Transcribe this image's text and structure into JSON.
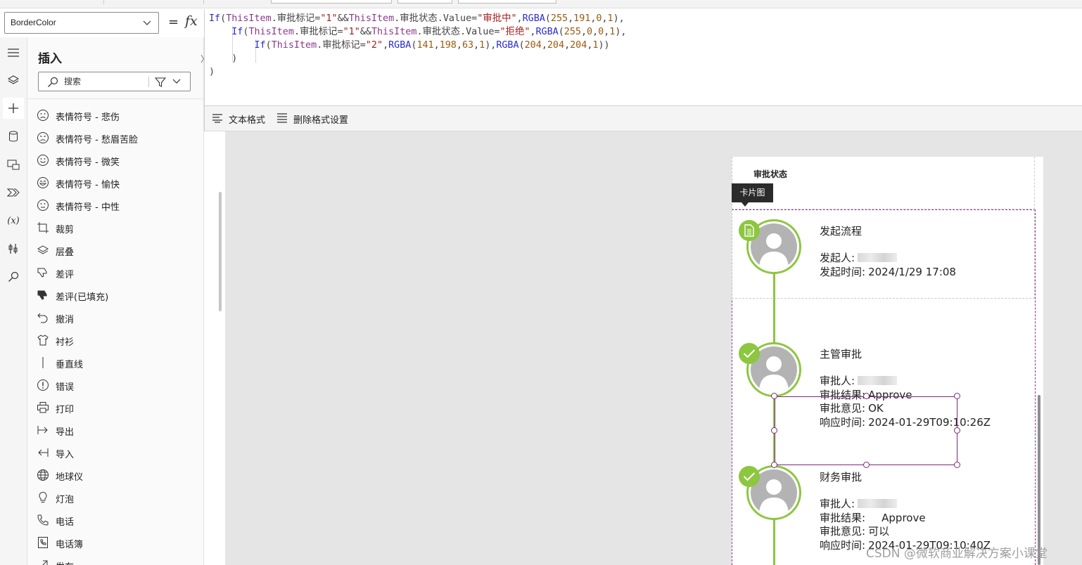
{
  "property": {
    "selected": "BorderColor",
    "equals": "=",
    "fx": "fx"
  },
  "formula": {
    "lines": [
      [
        {
          "t": "If",
          "c": "k"
        },
        {
          "t": "(",
          "c": "p"
        },
        {
          "t": "ThisItem",
          "c": "i"
        },
        {
          "t": ".审批标记=",
          "c": "p"
        },
        {
          "t": "\"1\"",
          "c": "s"
        },
        {
          "t": "&&",
          "c": "p"
        },
        {
          "t": "ThisItem",
          "c": "i"
        },
        {
          "t": ".审批状态.Value=",
          "c": "p"
        },
        {
          "t": "\"审批中\"",
          "c": "s"
        },
        {
          "t": ",",
          "c": "p"
        },
        {
          "t": "RGBA",
          "c": "k"
        },
        {
          "t": "(",
          "c": "p"
        },
        {
          "t": "255",
          "c": "n"
        },
        {
          "t": ",",
          "c": "p"
        },
        {
          "t": "191",
          "c": "n"
        },
        {
          "t": ",",
          "c": "p"
        },
        {
          "t": "0",
          "c": "n"
        },
        {
          "t": ",",
          "c": "p"
        },
        {
          "t": "1",
          "c": "n"
        },
        {
          "t": "),",
          "c": "p"
        }
      ],
      [
        {
          "t": "    ",
          "c": "p"
        },
        {
          "t": "If",
          "c": "k"
        },
        {
          "t": "(",
          "c": "p"
        },
        {
          "t": "ThisItem",
          "c": "i"
        },
        {
          "t": ".审批标记=",
          "c": "p"
        },
        {
          "t": "\"1\"",
          "c": "s"
        },
        {
          "t": "&&",
          "c": "p"
        },
        {
          "t": "ThisItem",
          "c": "i"
        },
        {
          "t": ".审批状态.Value=",
          "c": "p"
        },
        {
          "t": "\"拒绝\"",
          "c": "s"
        },
        {
          "t": ",",
          "c": "p"
        },
        {
          "t": "RGBA",
          "c": "k"
        },
        {
          "t": "(",
          "c": "p"
        },
        {
          "t": "255",
          "c": "n"
        },
        {
          "t": ",",
          "c": "p"
        },
        {
          "t": "0",
          "c": "n"
        },
        {
          "t": ",",
          "c": "p"
        },
        {
          "t": "0",
          "c": "n"
        },
        {
          "t": ",",
          "c": "p"
        },
        {
          "t": "1",
          "c": "n"
        },
        {
          "t": "),",
          "c": "p"
        }
      ],
      [
        {
          "t": "        ",
          "c": "p"
        },
        {
          "t": "If",
          "c": "k"
        },
        {
          "t": "(",
          "c": "p"
        },
        {
          "t": "ThisItem",
          "c": "i"
        },
        {
          "t": ".审批标记=",
          "c": "p"
        },
        {
          "t": "\"2\"",
          "c": "s"
        },
        {
          "t": ",",
          "c": "p"
        },
        {
          "t": "RGBA",
          "c": "k"
        },
        {
          "t": "(",
          "c": "p"
        },
        {
          "t": "141",
          "c": "n"
        },
        {
          "t": ",",
          "c": "p"
        },
        {
          "t": "198",
          "c": "n"
        },
        {
          "t": ",",
          "c": "p"
        },
        {
          "t": "63",
          "c": "n"
        },
        {
          "t": ",",
          "c": "p"
        },
        {
          "t": "1",
          "c": "n"
        },
        {
          "t": "),",
          "c": "p"
        },
        {
          "t": "RGBA",
          "c": "k"
        },
        {
          "t": "(",
          "c": "p"
        },
        {
          "t": "204",
          "c": "n"
        },
        {
          "t": ",",
          "c": "p"
        },
        {
          "t": "204",
          "c": "n"
        },
        {
          "t": ",",
          "c": "p"
        },
        {
          "t": "204",
          "c": "n"
        },
        {
          "t": ",",
          "c": "p"
        },
        {
          "t": "1",
          "c": "n"
        },
        {
          "t": "))",
          "c": "p"
        }
      ],
      [
        {
          "t": "    )",
          "c": "p"
        }
      ],
      [
        {
          "t": ")",
          "c": "p"
        }
      ]
    ]
  },
  "format_bar": {
    "text_format": "文本格式",
    "remove_format": "删除格式设置"
  },
  "left_rail": {
    "items": [
      "hamburger-icon",
      "layers-icon",
      "plus-icon",
      "database-icon",
      "media-icon",
      "flow-icon",
      "variable-icon",
      "tools-icon",
      "search-icon"
    ],
    "variable_glyph": "(x)"
  },
  "insert_pane": {
    "title": "插入",
    "close_glyph": "〉",
    "search_placeholder": "搜索",
    "items": [
      {
        "label": "表情符号 - 悲伤",
        "icon": "sad-face-icon"
      },
      {
        "label": "表情符号 - 愁眉苦脸",
        "icon": "frown-face-icon"
      },
      {
        "label": "表情符号 - 微笑",
        "icon": "smile-face-icon"
      },
      {
        "label": "表情符号 - 愉快",
        "icon": "happy-face-icon"
      },
      {
        "label": "表情符号 - 中性",
        "icon": "neutral-face-icon"
      },
      {
        "label": "裁剪",
        "icon": "crop-icon"
      },
      {
        "label": "层叠",
        "icon": "layers-icon"
      },
      {
        "label": "差评",
        "icon": "thumbs-down-icon"
      },
      {
        "label": "差评(已填充)",
        "icon": "thumbs-down-filled-icon"
      },
      {
        "label": "撤消",
        "icon": "undo-icon"
      },
      {
        "label": "衬衫",
        "icon": "shirt-icon"
      },
      {
        "label": "垂直线",
        "icon": "vertical-line-icon"
      },
      {
        "label": "错误",
        "icon": "error-icon"
      },
      {
        "label": "打印",
        "icon": "print-icon"
      },
      {
        "label": "导出",
        "icon": "export-icon"
      },
      {
        "label": "导入",
        "icon": "import-icon"
      },
      {
        "label": "地球仪",
        "icon": "globe-icon"
      },
      {
        "label": "灯泡",
        "icon": "lightbulb-icon"
      },
      {
        "label": "电话",
        "icon": "phone-icon"
      },
      {
        "label": "电话簿",
        "icon": "phonebook-icon"
      },
      {
        "label": "发布",
        "icon": "publish-icon"
      }
    ]
  },
  "canvas": {
    "header_title": "审批状态",
    "tooltip": "卡片图",
    "steps": [
      {
        "title": "发起流程",
        "lines": [
          {
            "label": "发起人:",
            "value": "",
            "redacted": true
          },
          {
            "label": "发起时间:",
            "value": "2024/1/29 17:08"
          }
        ],
        "badge": "document-icon"
      },
      {
        "title": "主管审批",
        "lines": [
          {
            "label": "审批人:",
            "value": "",
            "redacted": true
          },
          {
            "label": "审批结果:",
            "value": "Approve"
          },
          {
            "label": "审批意见:",
            "value": "OK"
          },
          {
            "label": "响应时间:",
            "value": "2024-01-29T09:10:26Z"
          }
        ],
        "badge": "check-icon"
      },
      {
        "title": "财务审批",
        "lines": [
          {
            "label": "审批人:",
            "value": "",
            "redacted": true
          },
          {
            "label": "审批结果:",
            "value": "    Approve"
          },
          {
            "label": "审批意见:",
            "value": "可以"
          },
          {
            "label": "响应时间:",
            "value": "2024-01-29T09:10:40Z"
          }
        ],
        "badge": "check-icon"
      }
    ]
  },
  "watermark": "CSDN @微软商业解决方案小课堂",
  "colors": {
    "accent_green": "#8dc63f",
    "selection_purple": "#7a2a7a",
    "tooltip_bg": "#2b2b2b"
  }
}
